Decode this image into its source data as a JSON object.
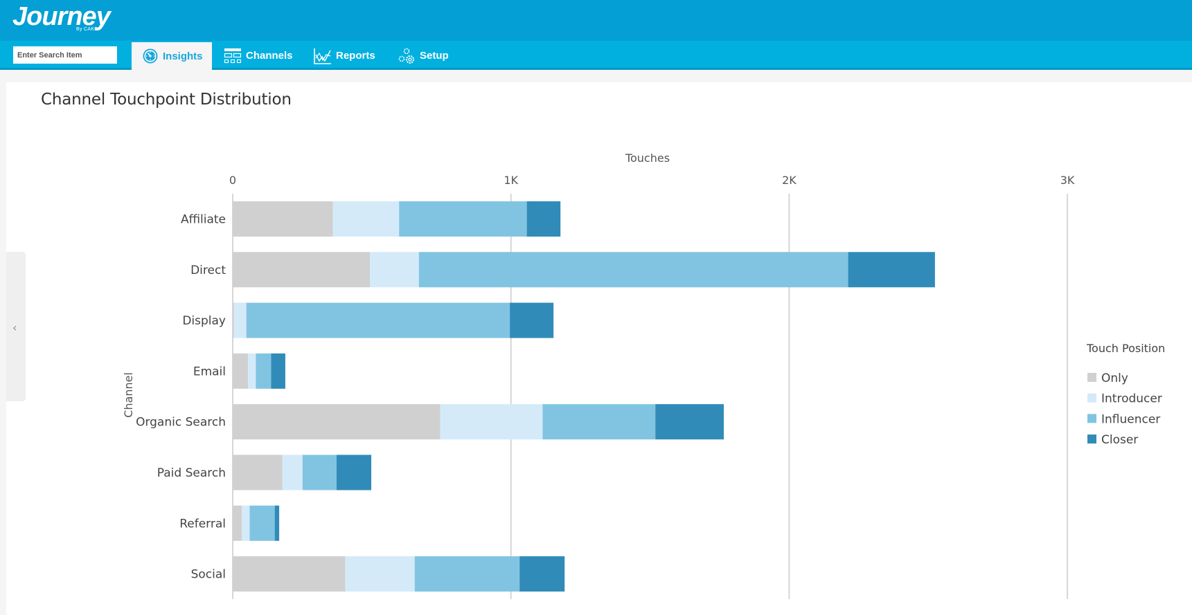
{
  "header": {
    "logo": "Journey",
    "logo_sub": "By CAKE"
  },
  "nav": {
    "search_placeholder": "Enter Search Item",
    "tabs": [
      {
        "label": "Insights",
        "icon": "dashboard-gauge-icon",
        "active": true
      },
      {
        "label": "Channels",
        "icon": "layout-grid-icon",
        "active": false
      },
      {
        "label": "Reports",
        "icon": "line-chart-icon",
        "active": false
      },
      {
        "label": "Setup",
        "icon": "gears-icon",
        "active": false
      }
    ]
  },
  "page": {
    "title": "Channel Touchpoint Distribution",
    "side_toggle_icon": "chevron-left-icon"
  },
  "chart_data": {
    "type": "bar",
    "orientation": "horizontal",
    "stacked": true,
    "title": "Channel Touchpoint Distribution",
    "xlabel": "Touches",
    "ylabel": "Channel",
    "xlim": [
      0,
      3000
    ],
    "xticks": [
      0,
      1000,
      2000,
      3000
    ],
    "xtick_labels": [
      "0",
      "1K",
      "2K",
      "3K"
    ],
    "x_axis_position": "top",
    "grid": true,
    "categories": [
      "Affiliate",
      "Direct",
      "Display",
      "Email",
      "Organic Search",
      "Paid Search",
      "Referral",
      "Social"
    ],
    "legend": {
      "title": "Touch Position",
      "position": "right"
    },
    "series": [
      {
        "name": "Only",
        "color": "#d0d0d0",
        "values": [
          360,
          493,
          4,
          55,
          746,
          178,
          33,
          405
        ]
      },
      {
        "name": "Introducer",
        "color": "#d4eaf9",
        "values": [
          238,
          176,
          45,
          28,
          368,
          73,
          28,
          249
        ]
      },
      {
        "name": "Influencer",
        "color": "#81c4e2",
        "values": [
          459,
          1543,
          947,
          55,
          405,
          122,
          90,
          377
        ]
      },
      {
        "name": "Closer",
        "color": "#318bb8",
        "values": [
          121,
          312,
          157,
          51,
          246,
          125,
          16,
          162
        ]
      }
    ]
  }
}
